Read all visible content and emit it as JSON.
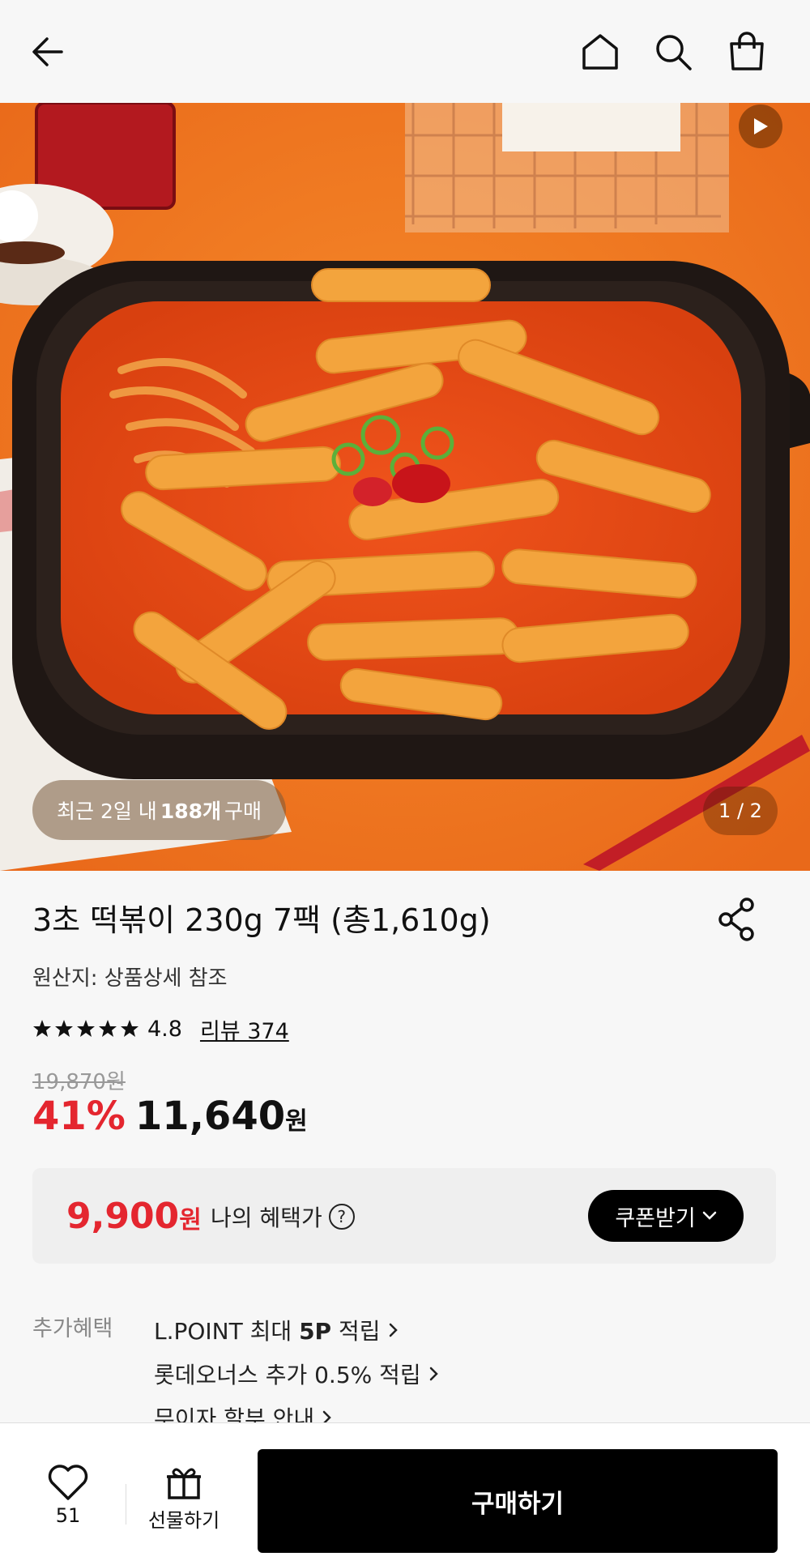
{
  "header": {
    "back_icon": "back-arrow-icon",
    "home_icon": "home-icon",
    "search_icon": "search-icon",
    "cart_icon": "shopping-bag-icon"
  },
  "hero": {
    "recent_prefix": "최근 2일 내",
    "recent_count": "188개",
    "recent_suffix": "구매",
    "pager": "1 / 2",
    "video_icon": "play-icon"
  },
  "product": {
    "title": "3초 떡볶이 230g 7팩 (총1,610g)",
    "origin": "원산지: 상품상세 참조",
    "rating": "4.8",
    "rating_stars": 5,
    "review_link": "리뷰 374",
    "original_price": "19,870원",
    "discount": "41%",
    "price": "11,640",
    "price_unit": "원"
  },
  "benefit": {
    "price": "9,900",
    "price_unit": "원",
    "label": "나의 혜택가",
    "coupon_button": "쿠폰받기"
  },
  "extra": {
    "label": "추가혜택",
    "items": [
      {
        "pre": "L.POINT 최대 ",
        "bold": "5P",
        "post": " 적립"
      },
      {
        "pre": "롯데오너스 추가 0.5% 적립",
        "bold": "",
        "post": ""
      },
      {
        "pre": "무이자 할부 안내",
        "bold": "",
        "post": ""
      }
    ]
  },
  "bottom": {
    "like_count": "51",
    "gift_label": "선물하기",
    "buy_label": "구매하기"
  },
  "colors": {
    "accent_red": "#e4262f",
    "hero_orange": "#f27a1f"
  }
}
